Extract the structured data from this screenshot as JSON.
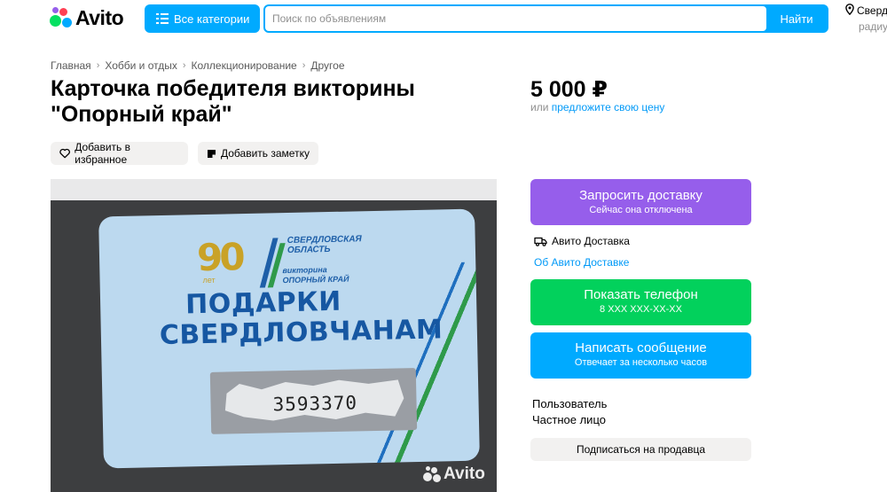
{
  "header": {
    "logo_text": "Avito",
    "categories_label": "Все категории",
    "search_placeholder": "Поиск по объявлениям",
    "search_button": "Найти",
    "location_text": "Сверд",
    "location_sub": "радиу",
    "colors": {
      "accent": "#00aaff"
    }
  },
  "breadcrumbs": [
    "Главная",
    "Хобби и отдых",
    "Коллекционирование",
    "Другое"
  ],
  "listing": {
    "title_line1": "Карточка победителя викторины",
    "title_line2": "\"Опорный край\"",
    "price": "5 000 ₽",
    "price_hint_prefix": "или ",
    "price_hint_link": "предложите свою цену",
    "favorite_label": "Добавить в избранное",
    "note_label": "Добавить заметку"
  },
  "photo": {
    "card_anniversary": "90",
    "card_years": "лет",
    "card_org": "СВЕРДЛОВСКАЯ ОБЛАСТЬ",
    "card_quiz": "викторина",
    "card_quiz_name": "ОПОРНЫЙ КРАЙ",
    "card_headline1": "ПОДАРКИ",
    "card_headline2": "СВЕРДЛОВЧАНАМ",
    "card_number": "3593370",
    "watermark": "Avito"
  },
  "actions": {
    "delivery_title": "Запросить доставку",
    "delivery_sub": "Сейчас она отключена",
    "avito_delivery": "Авито Доставка",
    "about_delivery": "Об Авито Доставке",
    "phone_title": "Показать телефон",
    "phone_sub": "8 XXX XXX-XX-XX",
    "message_title": "Написать сообщение",
    "message_sub": "Отвечает за несколько часов",
    "colors": {
      "delivery": "#965eeb",
      "phone": "#02d15c",
      "message": "#00aaff"
    }
  },
  "seller": {
    "name": "Пользователь",
    "type": "Частное лицо",
    "subscribe": "Подписаться на продавца"
  }
}
